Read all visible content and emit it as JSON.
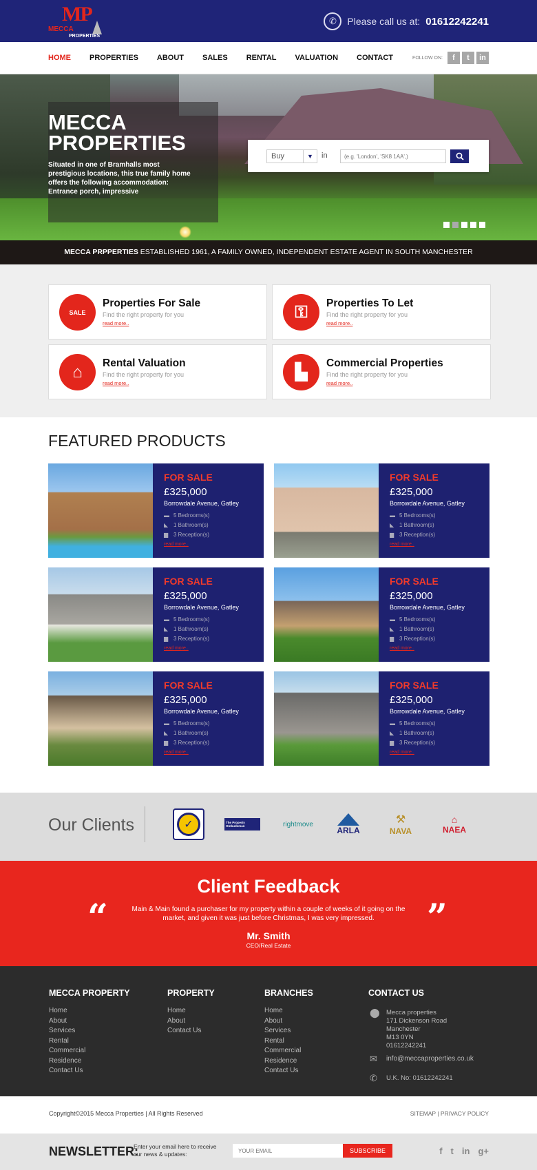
{
  "header": {
    "logo_mp": "MP",
    "logo_mecca": "MECCA",
    "logo_properties": "PROPERTIES",
    "call_label": "Please call us at:",
    "phone": "01612242241"
  },
  "nav": {
    "items": [
      "HOME",
      "PROPERTIES",
      "ABOUT",
      "SALES",
      "RENTAL",
      "VALUATION",
      "CONTACT"
    ],
    "active": "HOME",
    "follow_label": "FOLLOW ON:",
    "social": [
      "f",
      "t",
      "in"
    ]
  },
  "hero": {
    "title_line1": "MECCA",
    "title_line2": "PROPERTIES",
    "text": "Situated in one of Bramhalls most prestigious locations, this true family home offers the following accommodation: Entrance porch, impressive",
    "search": {
      "type_value": "Buy",
      "in_label": "in",
      "placeholder": "(e.g. 'London', 'SK8 1AA',)"
    },
    "slides": 5,
    "active_slide": 2
  },
  "established": {
    "bold": "MECCA PRPPERTIES",
    "rest": " ESTABLISHED 1961, A FAMILY OWNED, INDEPENDENT ESTATE AGENT IN SOUTH MANCHESTER"
  },
  "services": [
    {
      "title": "Properties For Sale",
      "subtitle": "Find the right property for you",
      "link": "read more..",
      "icon": "sale-tag-icon",
      "glyph": "SALE"
    },
    {
      "title": "Properties To Let",
      "subtitle": "Find the right property for you",
      "link": "read more..",
      "icon": "keys-icon",
      "glyph": "⚿"
    },
    {
      "title": "Rental Valuation",
      "subtitle": "Find the right property for you",
      "link": "read more..",
      "icon": "house-icon",
      "glyph": "⌂"
    },
    {
      "title": "Commercial Properties",
      "subtitle": "Find the right property for you",
      "link": "read more..",
      "icon": "buildings-icon",
      "glyph": "▙"
    }
  ],
  "featured": {
    "title": "FEATURED PRODUCTS",
    "properties": [
      {
        "status": "FOR SALE",
        "price": "£325,000",
        "address": "Borrowdale Avenue, Gatley",
        "beds": "5 Bedrooms(s)",
        "baths": "1 Bathroom(s)",
        "recep": "3 Reception(s)",
        "link": "read more.."
      },
      {
        "status": "FOR SALE",
        "price": "£325,000",
        "address": "Borrowdale Avenue, Gatley",
        "beds": "5 Bedrooms(s)",
        "baths": "1 Bathroom(s)",
        "recep": "3 Reception(s)",
        "link": "read more.."
      },
      {
        "status": "FOR SALE",
        "price": "£325,000",
        "address": "Borrowdale Avenue, Gatley",
        "beds": "5 Bedrooms(s)",
        "baths": "1 Bathroom(s)",
        "recep": "3 Reception(s)",
        "link": "read more.."
      },
      {
        "status": "FOR SALE",
        "price": "£325,000",
        "address": "Borrowdale Avenue, Gatley",
        "beds": "5 Bedrooms(s)",
        "baths": "1 Bathroom(s)",
        "recep": "3 Reception(s)",
        "link": "read more.."
      },
      {
        "status": "FOR SALE",
        "price": "£325,000",
        "address": "Borrowdale Avenue, Gatley",
        "beds": "5 Bedrooms(s)",
        "baths": "1 Bathroom(s)",
        "recep": "3 Reception(s)",
        "link": "read more.."
      },
      {
        "status": "FOR SALE",
        "price": "£325,000",
        "address": "Borrowdale Avenue, Gatley",
        "beds": "5 Bedrooms(s)",
        "baths": "1 Bathroom(s)",
        "recep": "3 Reception(s)",
        "link": "read more.."
      }
    ]
  },
  "clients": {
    "title": "Our Clients",
    "logos": [
      "APPROVED MAIN",
      "The Property Ombudsman",
      "rightmove",
      "ARLA",
      "NAVA",
      "NAEA"
    ]
  },
  "feedback": {
    "title": "Client Feedback",
    "quote": "Main & Main found a purchaser for my property within a couple of weeks of it going on the market, and given it was just before Christmas, I was very impressed.",
    "name": "Mr. Smith",
    "role": "CEO/Real Estate"
  },
  "footer": {
    "col1": {
      "title": "MECCA PROPERTY",
      "links": [
        "Home",
        "About",
        "Services",
        "Rental",
        "Commercial",
        "Residence",
        "Contact Us"
      ]
    },
    "col2": {
      "title": "PROPERTY",
      "links": [
        "Home",
        "About",
        "Contact Us"
      ]
    },
    "col3": {
      "title": "BRANCHES",
      "links": [
        "Home",
        "About",
        "Services",
        "Rental",
        "Commercial",
        "Residence",
        "Contact Us"
      ]
    },
    "contact": {
      "title": "CONTACT US",
      "address_lines": [
        "Mecca properties",
        "171 Dickenson Road",
        "Manchester",
        "M13 0YN",
        "01612242241"
      ],
      "email": "info@meccaproperties.co.uk",
      "phone": "U.K. No: 01612242241"
    }
  },
  "copyright": {
    "text": "Copyright©2015 Mecca Properties | All Rights Reserved",
    "sitemap": "SITEMAP",
    "sep": "|",
    "privacy": "PRIVACY POLICY"
  },
  "newsletter": {
    "title": "NEWSLETTER:",
    "subtitle": "Enter your email here to receive our news & updates:",
    "placeholder": "YOUR EMAIL",
    "button": "SUBSCRIBE",
    "social": [
      "f",
      "t",
      "in",
      "g+"
    ]
  },
  "colors": {
    "brand_navy": "#1f2478",
    "accent_red": "#e3261c",
    "footer_dark": "#2c2c2c"
  }
}
